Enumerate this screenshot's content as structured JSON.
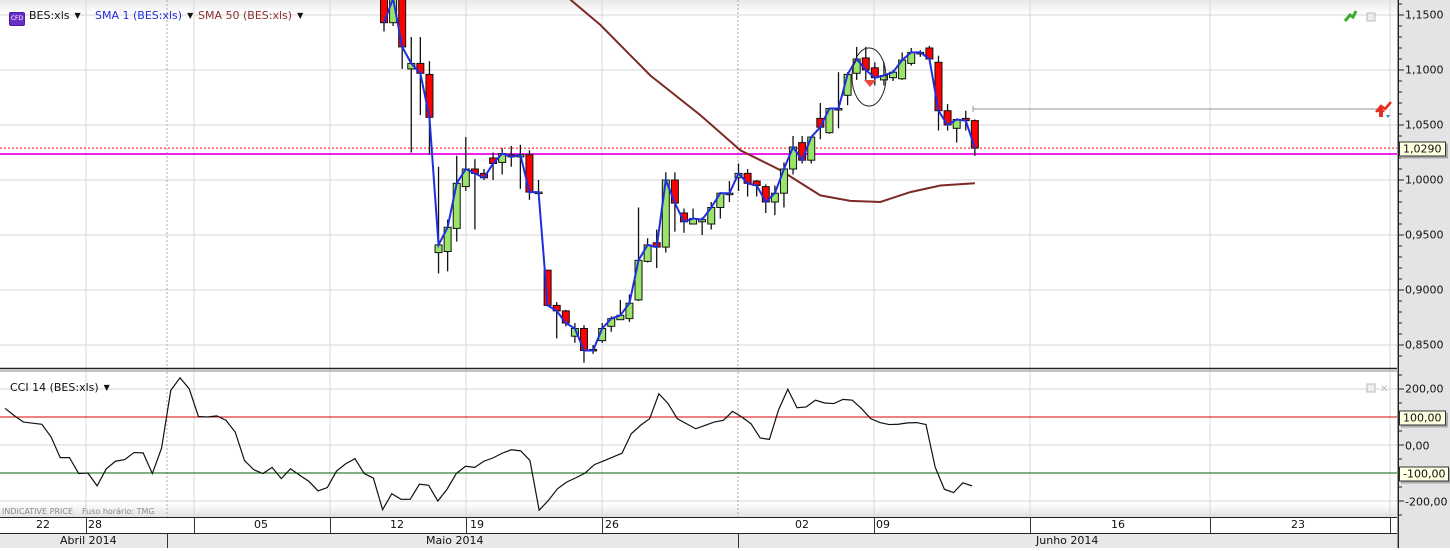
{
  "header": {
    "cfd_badge": "CFD",
    "symbol": "BES:xls",
    "sma1_label": "SMA 1 (BES:xls)",
    "sma50_label": "SMA 50 (BES:xls)"
  },
  "price_axis": {
    "labels": [
      "1,1500",
      "1,1000",
      "1,0500",
      "1,0000",
      "0,9500",
      "0,9000",
      "0,8500"
    ],
    "current_price": "1,0290"
  },
  "cci_panel": {
    "label": "CCI 14 (BES:xls)",
    "axis_labels": [
      "200,00",
      "0,00",
      "-200,00"
    ],
    "upper_level_label": "100,00",
    "lower_level_label": "-100,00"
  },
  "footer": {
    "indicative": "INDICATIVE PRICE",
    "timezone": "Fuso horário: TMG"
  },
  "date_axis": {
    "days": [
      "22",
      "28",
      "05",
      "12",
      "19",
      "26",
      "02",
      "09",
      "16",
      "23"
    ],
    "months": [
      "Abril 2014",
      "Maio 2014",
      "Junho 2014"
    ]
  },
  "colors": {
    "up": "#9be36a",
    "down": "#ff0000",
    "sma1": "#1f2fe0",
    "sma50": "#7b2a25",
    "support_line": "#ee22ee",
    "price_line": "#ff0000",
    "cci_upper": "#dd0000",
    "cci_lower": "#006600"
  },
  "chart_data": {
    "type": "candlestick",
    "ylim": [
      0.835,
      1.163
    ],
    "yticks": [
      1.15,
      1.1,
      1.05,
      1.0,
      0.95,
      0.9,
      0.85
    ],
    "candles_ohlc": [
      [
        1.175,
        1.18,
        1.135,
        1.143
      ],
      [
        1.143,
        1.175,
        1.14,
        1.165
      ],
      [
        1.175,
        1.18,
        1.101,
        1.121
      ],
      [
        1.101,
        1.13,
        1.025,
        1.106
      ],
      [
        1.106,
        1.13,
        1.059,
        1.097
      ],
      [
        1.096,
        1.108,
        1.023,
        1.057
      ],
      [
        0.934,
        1.012,
        0.915,
        0.941
      ],
      [
        0.935,
        0.964,
        0.917,
        0.957
      ],
      [
        0.956,
        1.022,
        0.944,
        0.997
      ],
      [
        0.994,
        1.039,
        0.99,
        1.01
      ],
      [
        1.01,
        1.019,
        0.955,
        1.006
      ],
      [
        1.006,
        1.01,
        1.0,
        1.002
      ],
      [
        1.02,
        1.025,
        1.0,
        1.015
      ],
      [
        1.016,
        1.029,
        1.005,
        1.024
      ],
      [
        1.023,
        1.031,
        1.012,
        1.021
      ],
      [
        1.021,
        1.032,
        0.992,
        1.023
      ],
      [
        1.023,
        1.027,
        0.982,
        0.989
      ],
      [
        0.989,
        1.0,
        0.989,
        0.989
      ],
      [
        0.918,
        0.918,
        0.886,
        0.886
      ],
      [
        0.886,
        0.889,
        0.856,
        0.881
      ],
      [
        0.881,
        0.882,
        0.867,
        0.87
      ],
      [
        0.858,
        0.87,
        0.852,
        0.865
      ],
      [
        0.865,
        0.868,
        0.834,
        0.845
      ],
      [
        0.846,
        0.85,
        0.842,
        0.845
      ],
      [
        0.854,
        0.87,
        0.852,
        0.865
      ],
      [
        0.867,
        0.876,
        0.862,
        0.874
      ],
      [
        0.873,
        0.891,
        0.873,
        0.877
      ],
      [
        0.874,
        0.896,
        0.871,
        0.888
      ],
      [
        0.891,
        0.975,
        0.89,
        0.927
      ],
      [
        0.926,
        0.947,
        0.925,
        0.941
      ],
      [
        0.943,
        0.955,
        0.92,
        0.939
      ],
      [
        0.939,
        1.007,
        0.934,
        1.0
      ],
      [
        1.0,
        1.007,
        0.953,
        0.979
      ],
      [
        0.97,
        0.974,
        0.952,
        0.962
      ],
      [
        0.96,
        0.974,
        0.96,
        0.965
      ],
      [
        0.962,
        0.966,
        0.95,
        0.964
      ],
      [
        0.96,
        0.98,
        0.955,
        0.975
      ],
      [
        0.975,
        0.989,
        0.965,
        0.988
      ],
      [
        0.987,
        0.999,
        0.98,
        0.988
      ],
      [
        1.002,
        1.015,
        0.99,
        1.006
      ],
      [
        1.006,
        1.01,
        0.985,
        0.997
      ],
      [
        0.999,
        1.0,
        0.985,
        0.995
      ],
      [
        0.994,
        0.996,
        0.97,
        0.98
      ],
      [
        0.98,
        0.995,
        0.968,
        0.988
      ],
      [
        0.988,
        1.016,
        0.975,
        1.01
      ],
      [
        1.01,
        1.04,
        1.005,
        1.03
      ],
      [
        1.034,
        1.04,
        1.015,
        1.018
      ],
      [
        1.018,
        1.04,
        1.015,
        1.039
      ],
      [
        1.056,
        1.07,
        1.037,
        1.048
      ],
      [
        1.043,
        1.065,
        1.042,
        1.065
      ],
      [
        1.065,
        1.098,
        1.047,
        1.065
      ],
      [
        1.077,
        1.098,
        1.068,
        1.096
      ],
      [
        1.097,
        1.121,
        1.091,
        1.11
      ],
      [
        1.111,
        1.121,
        1.091,
        1.1
      ],
      [
        1.102,
        1.107,
        1.086,
        1.093
      ],
      [
        1.091,
        1.107,
        1.086,
        1.095
      ],
      [
        1.093,
        1.1,
        1.09,
        1.098
      ],
      [
        1.092,
        1.116,
        1.091,
        1.109
      ],
      [
        1.106,
        1.12,
        1.104,
        1.116
      ],
      [
        1.116,
        1.118,
        1.112,
        1.116
      ],
      [
        1.12,
        1.122,
        1.11,
        1.11
      ],
      [
        1.107,
        1.113,
        1.045,
        1.063
      ],
      [
        1.063,
        1.069,
        1.045,
        1.05
      ],
      [
        1.047,
        1.056,
        1.034,
        1.055
      ],
      [
        1.056,
        1.063,
        1.045,
        1.054
      ],
      [
        1.054,
        1.055,
        1.022,
        1.029
      ]
    ],
    "sma50_points": [
      [
        20.5,
        1.164
      ],
      [
        23.8,
        1.141
      ],
      [
        29.3,
        1.095
      ],
      [
        34.8,
        1.059
      ],
      [
        39.2,
        1.027
      ],
      [
        43.6,
        1.009
      ],
      [
        48,
        0.986
      ],
      [
        51.3,
        0.981
      ],
      [
        54.6,
        0.98
      ],
      [
        57.9,
        0.989
      ],
      [
        61.2,
        0.995
      ],
      [
        65,
        0.997
      ]
    ],
    "support_level": 1.0236,
    "current_price": 1.029,
    "alert_level": 1.0645,
    "cci": {
      "levels": [
        100,
        -100
      ],
      "ylim": [
        -250,
        250
      ],
      "values": [
        131,
        105,
        82,
        78,
        74,
        29,
        -45,
        -45,
        -102,
        -100,
        -146,
        -85,
        -58,
        -52,
        -27,
        -28,
        -102,
        -11,
        195,
        240,
        201,
        102,
        100,
        104,
        88,
        46,
        -55,
        -88,
        -102,
        -80,
        -120,
        -85,
        -108,
        -130,
        -164,
        -152,
        -93,
        -67,
        -49,
        -102,
        -118,
        -231,
        -174,
        -194,
        -194,
        -140,
        -144,
        -200,
        -158,
        -102,
        -76,
        -80,
        -58,
        -46,
        -29,
        -17,
        -21,
        -55,
        -233,
        -198,
        -156,
        -132,
        -117,
        -100,
        -70,
        -57,
        -43,
        -29,
        40,
        70,
        94,
        183,
        148,
        94,
        76,
        58,
        70,
        82,
        88,
        120,
        100,
        76,
        25,
        20,
        126,
        199,
        133,
        136,
        160,
        150,
        148,
        163,
        160,
        130,
        94,
        80,
        73,
        74,
        79,
        80,
        73,
        -79,
        -158,
        -170,
        -135,
        -146
      ]
    }
  }
}
